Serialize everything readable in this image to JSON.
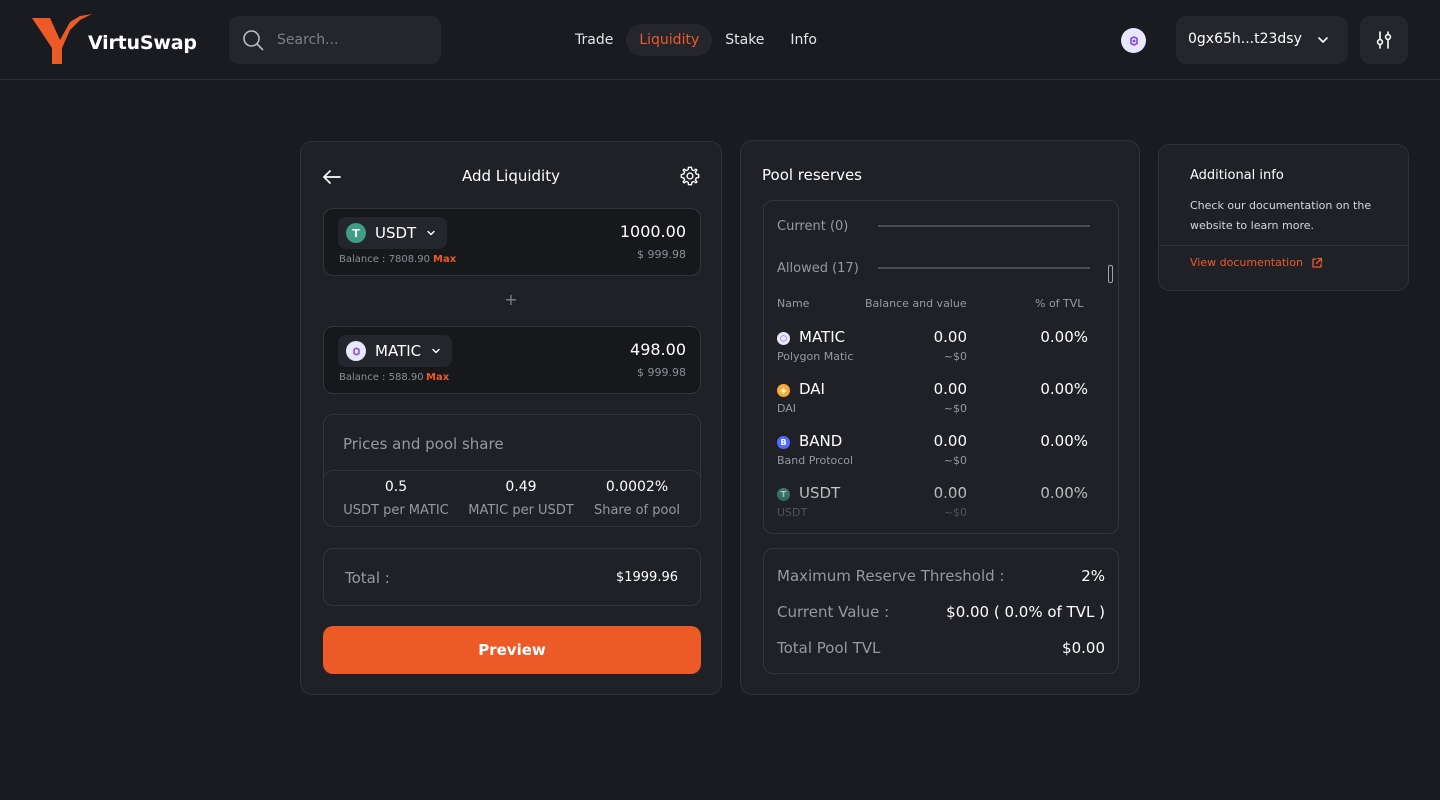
{
  "header": {
    "brand": "VirtuSwap",
    "search_placeholder": "Search...",
    "nav": [
      "Trade",
      "Liquidity",
      "Stake",
      "Info"
    ],
    "active_nav": "Liquidity",
    "wallet_address": "0gx65h...t23dsy",
    "network_icon": "polygon-icon"
  },
  "add_liquidity": {
    "title": "Add Liquidity",
    "token_a": {
      "symbol": "USDT",
      "balance_label": "Balance : 7808.90",
      "max_label": "Max",
      "amount": "1000.00",
      "usd_value": "$ 999.98"
    },
    "plus": "+",
    "token_b": {
      "symbol": "MATIC",
      "balance_label": "Balance : 588.90",
      "max_label": "Max",
      "amount": "498.00",
      "usd_value": "$ 999.98"
    },
    "prices": {
      "title": "Prices and pool share",
      "items": [
        {
          "value": "0.5",
          "label": "USDT per MATIC"
        },
        {
          "value": "0.49",
          "label": "MATIC per USDT"
        },
        {
          "value": "0.0002%",
          "label": "Share of pool"
        }
      ]
    },
    "total_label": "Total :",
    "total_value": "$1999.96",
    "preview_label": "Preview"
  },
  "pool_reserves": {
    "title": "Pool reserves",
    "current_label": "Current (0)",
    "allowed_label": "Allowed (17)",
    "columns": [
      "Name",
      "Balance and value",
      "% of TVL"
    ],
    "rows": [
      {
        "symbol": "MATIC",
        "name": "Polygon Matic",
        "balance": "0.00",
        "value": "~$0",
        "pct": "0.00%"
      },
      {
        "symbol": "DAI",
        "name": "DAI",
        "balance": "0.00",
        "value": "~$0",
        "pct": "0.00%"
      },
      {
        "symbol": "BAND",
        "name": "Band Protocol",
        "balance": "0.00",
        "value": "~$0",
        "pct": "0.00%"
      },
      {
        "symbol": "USDT",
        "name": "USDT",
        "balance": "0.00",
        "value": "~$0",
        "pct": "0.00%"
      }
    ],
    "threshold_label": "Maximum Reserve Threshold :",
    "threshold_value": "2%",
    "current_value_label": "Current Value :",
    "current_value": "$0.00 ( 0.0% of TVL )",
    "tvl_label": "Total Pool TVL",
    "tvl_value": "$0.00"
  },
  "additional_info": {
    "title": "Additional info",
    "text": "Check our documentation on the website to learn more.",
    "link_label": "View documentation"
  },
  "colors": {
    "accent": "#ec5a28",
    "background": "#1a1b20",
    "card": "#1f2127",
    "usdt": "#3d9e85",
    "dai": "#f5ac37",
    "band": "#516aff",
    "matic": "#8247e5"
  }
}
